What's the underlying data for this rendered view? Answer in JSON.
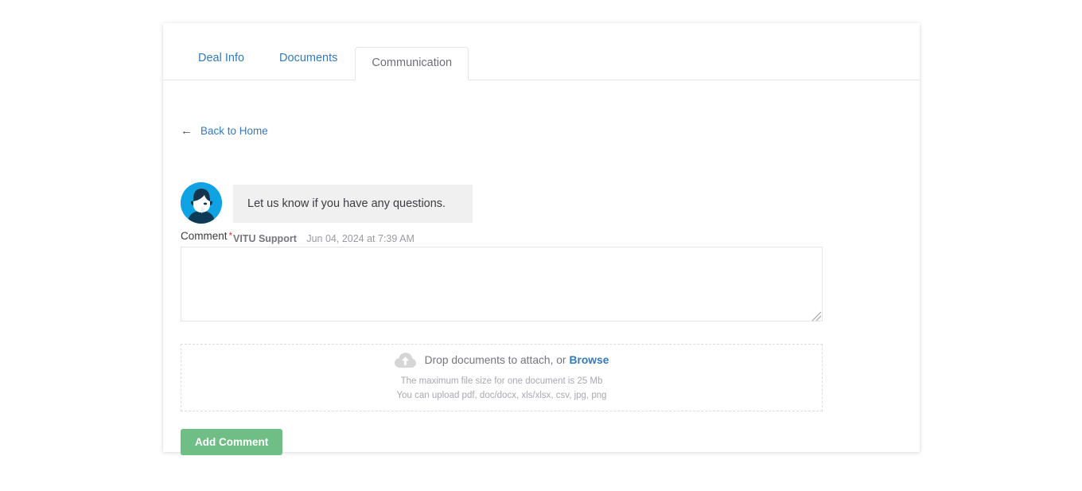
{
  "tabs": [
    {
      "label": "Deal Info",
      "active": false
    },
    {
      "label": "Documents",
      "active": false
    },
    {
      "label": "Communication",
      "active": true
    }
  ],
  "back_link": {
    "arrow": "←",
    "label": "Back to Home"
  },
  "message": {
    "avatar_name": "VITU Support avatar",
    "text": "Let us know if you have any questions.",
    "author": "VITU Support",
    "timestamp": "Jun 04, 2024 at 7:39 AM"
  },
  "comment_field": {
    "label": "Comment",
    "required_marker": "*",
    "value": "",
    "placeholder": ""
  },
  "dropzone": {
    "prompt": "Drop documents to attach, or",
    "browse_label": "Browse",
    "max_size_note": "The maximum file size for one document is 25 Mb",
    "formats_note": "You can upload pdf, doc/docx, xls/xlsx, csv, jpg, png"
  },
  "submit": {
    "label": "Add Comment"
  },
  "colors": {
    "link": "#337ab7",
    "accent_green": "#6ebe85",
    "avatar_blue": "#0fa3e3",
    "required_red": "#e0383e",
    "bubble_grey": "#f0f0f0"
  }
}
